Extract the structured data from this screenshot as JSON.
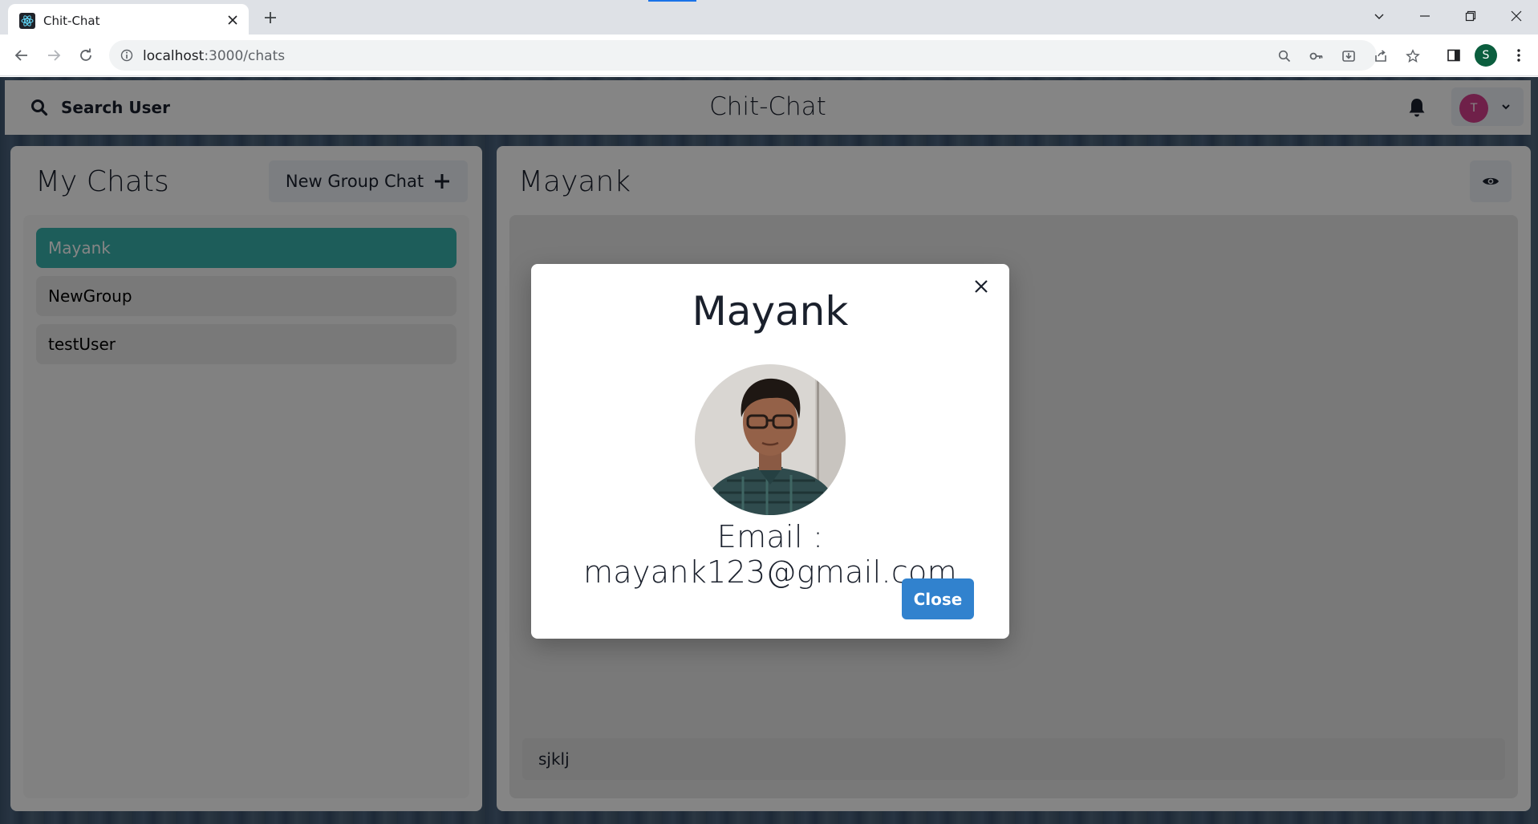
{
  "browser": {
    "tab_title": "Chit-Chat",
    "url_host": "localhost",
    "url_path": ":3000/chats",
    "profile_initial": "S"
  },
  "app": {
    "search_label": "Search User",
    "brand": "Chit-Chat",
    "user_initial": "T",
    "accent": "#38b2ac"
  },
  "mychats": {
    "title": "My Chats",
    "new_group_label": "New Group Chat",
    "items": [
      {
        "label": "Mayank",
        "selected": true
      },
      {
        "label": "NewGroup",
        "selected": false
      },
      {
        "label": "testUser",
        "selected": false
      }
    ]
  },
  "chat": {
    "title": "Mayank",
    "input_value": "sjklj"
  },
  "modal": {
    "title": "Mayank",
    "email_text": "Email : mayank123@gmail.com",
    "close_label": "Close"
  }
}
